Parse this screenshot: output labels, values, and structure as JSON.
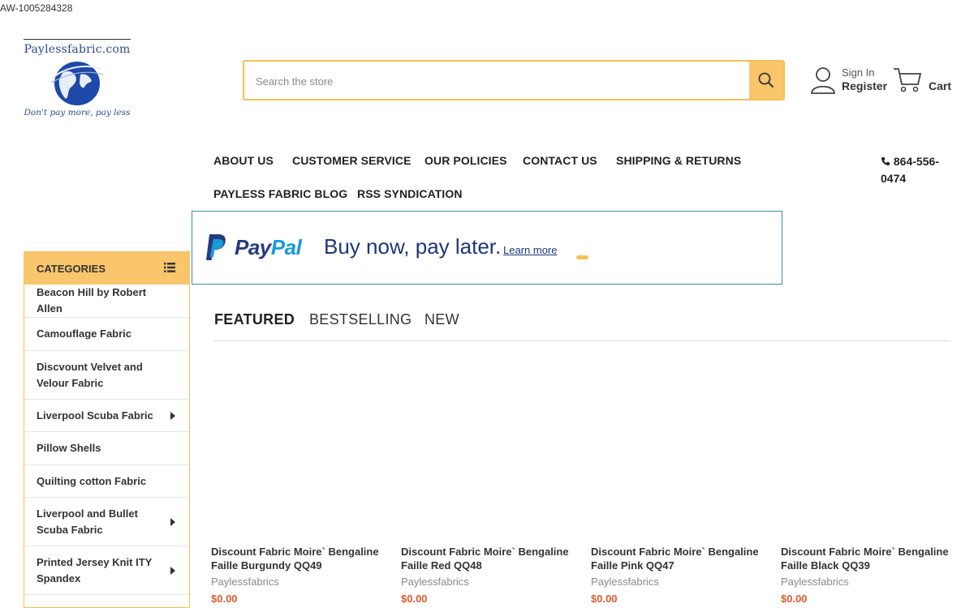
{
  "page_id": "AW-1005284328",
  "logo": {
    "brand": "Paylessfabric.com",
    "tagline": "Don't pay more, pay less"
  },
  "search": {
    "placeholder": "Search the store"
  },
  "account": {
    "sign_in": "Sign In",
    "register": "Register"
  },
  "cart": {
    "label": "Cart"
  },
  "nav": {
    "items": [
      "ABOUT US",
      "CUSTOMER SERVICE",
      "OUR POLICIES",
      "CONTACT US",
      "SHIPPING & RETURNS",
      "PAYLESS FABRIC BLOG",
      "RSS SYNDICATION"
    ],
    "phone": "864-556-0474"
  },
  "paypal": {
    "brand_part1": "Pay",
    "brand_part2": "Pal",
    "message": "Buy now, pay later.",
    "learn_more": "Learn more"
  },
  "categories": {
    "title": "CATEGORIES",
    "items": [
      {
        "label": "Beacon Hill by Robert Allen",
        "has_sub": false
      },
      {
        "label": "Camouflage Fabric",
        "has_sub": false
      },
      {
        "label": "Discvount Velvet and Velour Fabric",
        "has_sub": false
      },
      {
        "label": "Liverpool Scuba Fabric",
        "has_sub": true
      },
      {
        "label": "Pillow Shells",
        "has_sub": false
      },
      {
        "label": "Quilting cotton Fabric",
        "has_sub": false
      },
      {
        "label": "Liverpool and Bullet Scuba Fabric",
        "has_sub": true
      },
      {
        "label": "Printed Jersey Knit ITY Spandex",
        "has_sub": true
      }
    ]
  },
  "tabs": [
    "FEATURED",
    "BESTSELLING",
    "NEW"
  ],
  "products": [
    {
      "name": "Discount Fabric Moire` Bengaline Faille Burgundy QQ49",
      "brand": "Paylessfabrics",
      "price": "$0.00"
    },
    {
      "name": "Discount Fabric Moire` Bengaline Faille Red QQ48",
      "brand": "Paylessfabrics",
      "price": "$0.00"
    },
    {
      "name": "Discount Fabric Moire` Bengaline Faille Pink QQ47",
      "brand": "Paylessfabrics",
      "price": "$0.00"
    },
    {
      "name": "Discount Fabric Moire` Bengaline Faille Black QQ39",
      "brand": "Paylessfabrics",
      "price": "$0.00"
    }
  ],
  "colors": {
    "accent": "#f9c66b",
    "accent_border": "#f5c054",
    "price": "#e0592a",
    "paypal_dark": "#253b80",
    "paypal_light": "#179bd7"
  }
}
